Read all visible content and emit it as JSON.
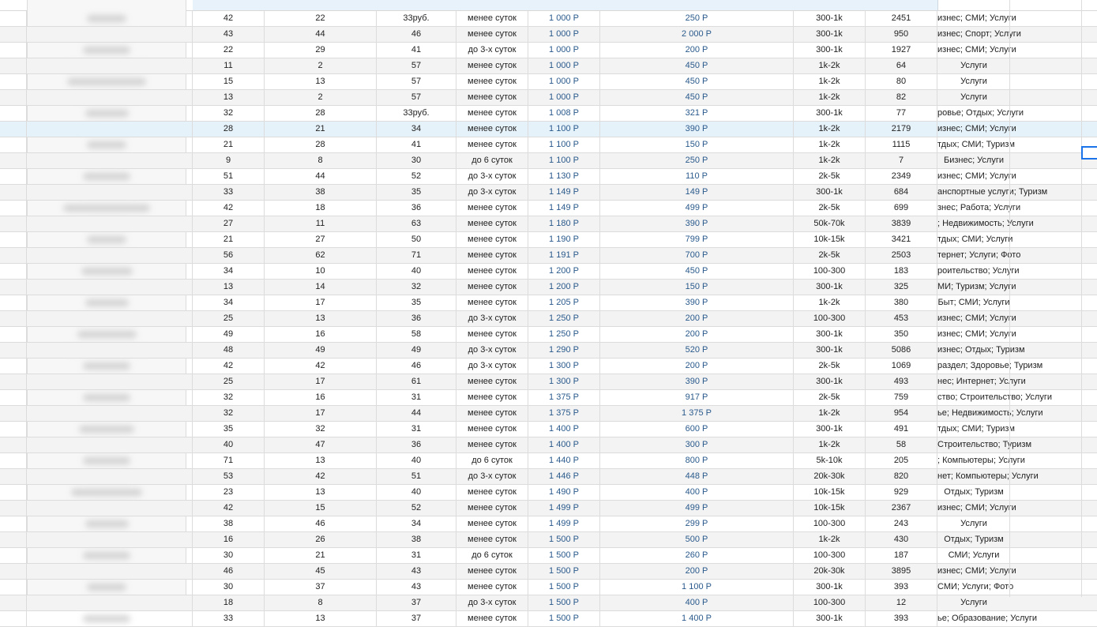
{
  "rows": [
    {
      "a": "42",
      "b": "22",
      "c": "33руб.",
      "d": "менее суток",
      "price": "1 000 Р",
      "min": "250 Р",
      "reach": "300-1k",
      "count": "2451",
      "cats": "изнес; СМИ; Услуги"
    },
    {
      "a": "43",
      "b": "44",
      "c": "46",
      "d": "менее суток",
      "price": "1 000 Р",
      "min": "2 000 Р",
      "reach": "300-1k",
      "count": "950",
      "cats": "изнес; Спорт; Услуги"
    },
    {
      "a": "22",
      "b": "29",
      "c": "41",
      "d": "до 3-х суток",
      "price": "1 000 Р",
      "min": "200 Р",
      "reach": "300-1k",
      "count": "1927",
      "cats": "изнес; СМИ; Услуги"
    },
    {
      "a": "11",
      "b": "2",
      "c": "57",
      "d": "менее суток",
      "price": "1 000 Р",
      "min": "450 Р",
      "reach": "1k-2k",
      "count": "64",
      "cats": "Услуги"
    },
    {
      "a": "15",
      "b": "13",
      "c": "57",
      "d": "менее суток",
      "price": "1 000 Р",
      "min": "450 Р",
      "reach": "1k-2k",
      "count": "80",
      "cats": "Услуги"
    },
    {
      "a": "13",
      "b": "2",
      "c": "57",
      "d": "менее суток",
      "price": "1 000 Р",
      "min": "450 Р",
      "reach": "1k-2k",
      "count": "82",
      "cats": "Услуги"
    },
    {
      "a": "32",
      "b": "28",
      "c": "33руб.",
      "d": "менее суток",
      "price": "1 008 Р",
      "min": "321 Р",
      "reach": "300-1k",
      "count": "77",
      "cats": "ровье; Отдых; Услуги"
    },
    {
      "a": "28",
      "b": "21",
      "c": "34",
      "d": "менее суток",
      "price": "1 100 Р",
      "min": "390 Р",
      "reach": "1k-2k",
      "count": "2179",
      "cats": "изнес; СМИ; Услуги"
    },
    {
      "a": "21",
      "b": "28",
      "c": "41",
      "d": "менее суток",
      "price": "1 100 Р",
      "min": "150 Р",
      "reach": "1k-2k",
      "count": "1115",
      "cats": "тдых; СМИ; Туризм"
    },
    {
      "a": "9",
      "b": "8",
      "c": "30",
      "d": "до 6 суток",
      "price": "1 100 Р",
      "min": "250 Р",
      "reach": "1k-2k",
      "count": "7",
      "cats": "Бизнес; Услуги"
    },
    {
      "a": "51",
      "b": "44",
      "c": "52",
      "d": "до 3-х суток",
      "price": "1 130 Р",
      "min": "110 Р",
      "reach": "2k-5k",
      "count": "2349",
      "cats": "изнес; СМИ; Услуги"
    },
    {
      "a": "33",
      "b": "38",
      "c": "35",
      "d": "до 3-х суток",
      "price": "1 149 Р",
      "min": "149 Р",
      "reach": "300-1k",
      "count": "684",
      "cats": "анспортные услуги; Туризм"
    },
    {
      "a": "42",
      "b": "18",
      "c": "36",
      "d": "менее суток",
      "price": "1 149 Р",
      "min": "499 Р",
      "reach": "2k-5k",
      "count": "699",
      "cats": "знес; Работа; Услуги"
    },
    {
      "a": "27",
      "b": "11",
      "c": "63",
      "d": "менее суток",
      "price": "1 180 Р",
      "min": "390 Р",
      "reach": "50k-70k",
      "count": "3839",
      "cats": "; Недвижимость; Услуги"
    },
    {
      "a": "21",
      "b": "27",
      "c": "50",
      "d": "менее суток",
      "price": "1 190 Р",
      "min": "799 Р",
      "reach": "10k-15k",
      "count": "3421",
      "cats": "тдых; СМИ; Услуги"
    },
    {
      "a": "56",
      "b": "62",
      "c": "71",
      "d": "менее суток",
      "price": "1 191 Р",
      "min": "700 Р",
      "reach": "2k-5k",
      "count": "2503",
      "cats": "тернет; Услуги; Фото"
    },
    {
      "a": "34",
      "b": "10",
      "c": "40",
      "d": "менее суток",
      "price": "1 200 Р",
      "min": "450 Р",
      "reach": "100-300",
      "count": "183",
      "cats": "роительство; Услуги"
    },
    {
      "a": "13",
      "b": "14",
      "c": "32",
      "d": "менее суток",
      "price": "1 200 Р",
      "min": "150 Р",
      "reach": "300-1k",
      "count": "325",
      "cats": "МИ; Туризм; Услуги"
    },
    {
      "a": "34",
      "b": "17",
      "c": "35",
      "d": "менее суток",
      "price": "1 205 Р",
      "min": "390 Р",
      "reach": "1k-2k",
      "count": "380",
      "cats": "Быт; СМИ; Услуги"
    },
    {
      "a": "25",
      "b": "13",
      "c": "36",
      "d": "до 3-х суток",
      "price": "1 250 Р",
      "min": "200 Р",
      "reach": "100-300",
      "count": "453",
      "cats": "изнес; СМИ; Услуги"
    },
    {
      "a": "49",
      "b": "16",
      "c": "58",
      "d": "менее суток",
      "price": "1 250 Р",
      "min": "200 Р",
      "reach": "300-1k",
      "count": "350",
      "cats": "изнес; СМИ; Услуги"
    },
    {
      "a": "48",
      "b": "49",
      "c": "49",
      "d": "до 3-х суток",
      "price": "1 290 Р",
      "min": "520 Р",
      "reach": "300-1k",
      "count": "5086",
      "cats": "изнес; Отдых; Туризм"
    },
    {
      "a": "42",
      "b": "42",
      "c": "46",
      "d": "до 3-х суток",
      "price": "1 300 Р",
      "min": "200 Р",
      "reach": "2k-5k",
      "count": "1069",
      "cats": " раздел; Здоровье; Туризм"
    },
    {
      "a": "25",
      "b": "17",
      "c": "61",
      "d": "менее суток",
      "price": "1 300 Р",
      "min": "390 Р",
      "reach": "300-1k",
      "count": "493",
      "cats": "нес; Интернет; Услуги"
    },
    {
      "a": "32",
      "b": "16",
      "c": "31",
      "d": "менее суток",
      "price": "1 375 Р",
      "min": "917 Р",
      "reach": "2k-5k",
      "count": "759",
      "cats": "ство; Строительство; Услуги"
    },
    {
      "a": "32",
      "b": "17",
      "c": "44",
      "d": "менее суток",
      "price": "1 375 Р",
      "min": "1 375 Р",
      "reach": "1k-2k",
      "count": "954",
      "cats": "ье; Недвижимость; Услуги"
    },
    {
      "a": "35",
      "b": "32",
      "c": "31",
      "d": "менее суток",
      "price": "1 400 Р",
      "min": "600 Р",
      "reach": "300-1k",
      "count": "491",
      "cats": "тдых; СМИ; Туризм"
    },
    {
      "a": "40",
      "b": "47",
      "c": "36",
      "d": "менее суток",
      "price": "1 400 Р",
      "min": "300 Р",
      "reach": "1k-2k",
      "count": "58",
      "cats": "Строительство; Туризм"
    },
    {
      "a": "71",
      "b": "13",
      "c": "40",
      "d": "до 6 суток",
      "price": "1 440 Р",
      "min": "800 Р",
      "reach": "5k-10k",
      "count": "205",
      "cats": "; Компьютеры; Услуги"
    },
    {
      "a": "53",
      "b": "42",
      "c": "51",
      "d": "до 3-х суток",
      "price": "1 446 Р",
      "min": "448 Р",
      "reach": "20k-30k",
      "count": "820",
      "cats": "нет; Компьютеры; Услуги"
    },
    {
      "a": "23",
      "b": "13",
      "c": "40",
      "d": "менее суток",
      "price": "1 490 Р",
      "min": "400 Р",
      "reach": "10k-15k",
      "count": "929",
      "cats": "Отдых; Туризм"
    },
    {
      "a": "42",
      "b": "15",
      "c": "52",
      "d": "менее суток",
      "price": "1 499 Р",
      "min": "499 Р",
      "reach": "10k-15k",
      "count": "2367",
      "cats": "изнес; СМИ; Услуги"
    },
    {
      "a": "38",
      "b": "46",
      "c": "34",
      "d": "менее суток",
      "price": "1 499 Р",
      "min": "299 Р",
      "reach": "100-300",
      "count": "243",
      "cats": "Услуги"
    },
    {
      "a": "16",
      "b": "26",
      "c": "38",
      "d": "менее суток",
      "price": "1 500 Р",
      "min": "500 Р",
      "reach": "1k-2k",
      "count": "430",
      "cats": "Отдых; Туризм"
    },
    {
      "a": "30",
      "b": "21",
      "c": "31",
      "d": "до 6 суток",
      "price": "1 500 Р",
      "min": "260 Р",
      "reach": "100-300",
      "count": "187",
      "cats": "СМИ; Услуги"
    },
    {
      "a": "46",
      "b": "45",
      "c": "43",
      "d": "менее суток",
      "price": "1 500 Р",
      "min": "200 Р",
      "reach": "20k-30k",
      "count": "3895",
      "cats": "изнес; СМИ; Услуги"
    },
    {
      "a": "30",
      "b": "37",
      "c": "43",
      "d": "менее суток",
      "price": "1 500 Р",
      "min": "1 100 Р",
      "reach": "300-1k",
      "count": "393",
      "cats": "СМИ; Услуги; Фото"
    },
    {
      "a": "18",
      "b": "8",
      "c": "37",
      "d": "до 3-х суток",
      "price": "1 500 Р",
      "min": "400 Р",
      "reach": "100-300",
      "count": "12",
      "cats": "Услуги"
    },
    {
      "a": "33",
      "b": "13",
      "c": "37",
      "d": "менее суток",
      "price": "1 500 Р",
      "min": "1 400 Р",
      "reach": "300-1k",
      "count": "393",
      "cats": "ье; Образование; Услуги"
    }
  ],
  "colors": {
    "accent": "#1a73e8",
    "money": "#2a5a8c",
    "selected_row": "#e6f2fa",
    "alt_row": "#f3f3f3"
  }
}
